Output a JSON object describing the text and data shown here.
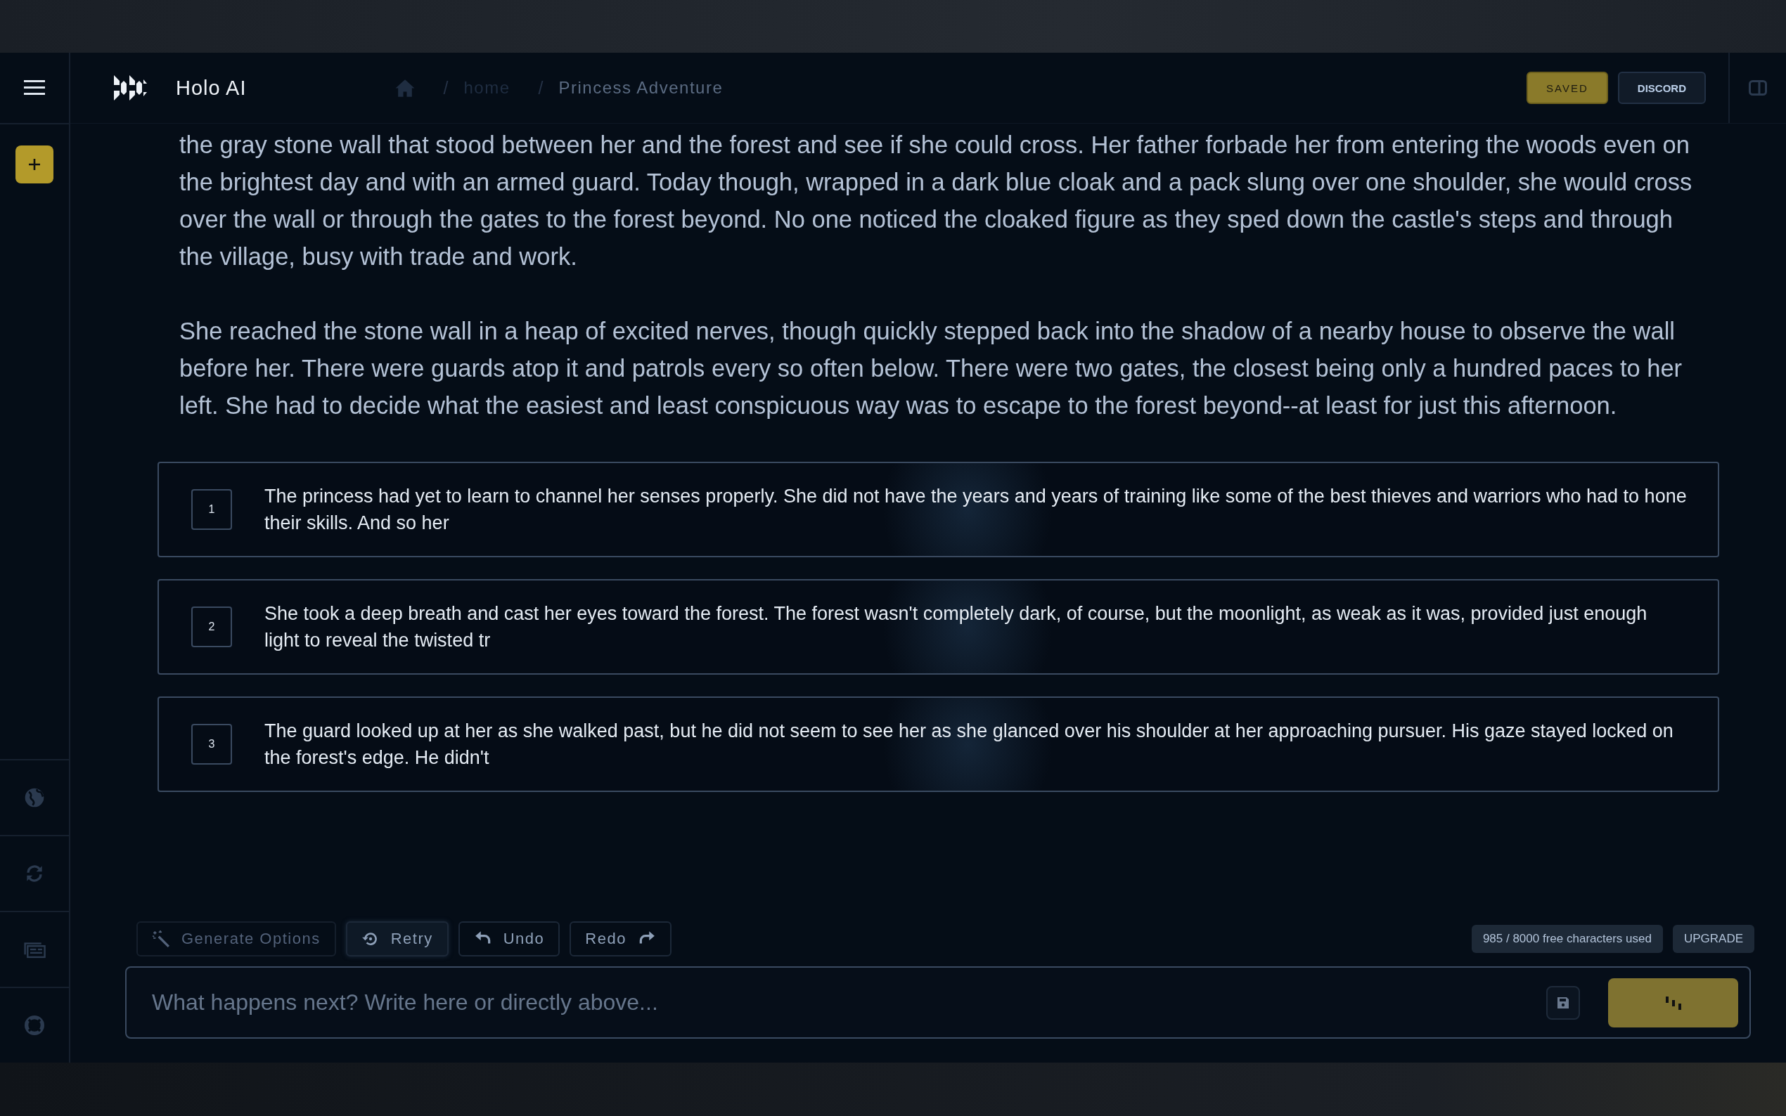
{
  "header": {
    "brand": "Holo AI",
    "breadcrumbs": [
      {
        "separator": "/",
        "label": "home",
        "current": false
      },
      {
        "separator": "/",
        "label": "Princess Adventure",
        "current": true
      }
    ],
    "buttons": [
      {
        "label": "SAVED",
        "kind": "primary"
      },
      {
        "label": "DISCORD",
        "kind": "secondary"
      }
    ]
  },
  "story": {
    "paragraphs": [
      "the gray stone wall that stood between her and the forest and see if she could cross. Her father forbade her from entering the woods even on the brightest day and with an armed guard. Today though, wrapped in a dark blue cloak and a pack slung over one shoulder, she would cross over the wall or through the gates to the forest beyond. No one noticed the cloaked figure as they sped down the castle's steps and through the village, busy with trade and work.",
      "She reached the stone wall in a heap of excited nerves, though quickly stepped back into the shadow of a nearby house to observe the wall before her. There were guards atop it and patrols every so often below. There were two gates, the closest being only a hundred paces to her left. She had to decide what the easiest and least conspicuous way was to escape to the forest beyond--at least for just this afternoon."
    ]
  },
  "options": [
    {
      "number": "1",
      "text": "The princess had yet to learn to channel her senses properly. She did not have the years and years of training like some of the best thieves and warriors who had to hone their skills. And so her"
    },
    {
      "number": "2",
      "text": "She took a deep breath and cast her eyes toward the forest. The forest wasn't completely dark, of course, but the moonlight, as weak as it was, provided just enough light to reveal the twisted tr"
    },
    {
      "number": "3",
      "text": "The guard looked up at her as she walked past, but he did not seem to see her as she glanced over his shoulder at her approaching pursuer. His gaze stayed locked on the forest's edge. He didn't"
    }
  ],
  "toolbar": {
    "buttons": [
      {
        "label": "Generate Options",
        "disabled": true,
        "highlighted": false
      },
      {
        "label": "Retry",
        "disabled": false,
        "highlighted": true
      },
      {
        "label": "Undo",
        "disabled": false,
        "highlighted": false
      },
      {
        "label": "Redo",
        "disabled": false,
        "highlighted": false
      }
    ]
  },
  "usage": {
    "text": "985 / 8000 free characters used",
    "upgrade": "UPGRADE"
  },
  "input": {
    "placeholder": "What happens next? Write here or directly above..."
  }
}
